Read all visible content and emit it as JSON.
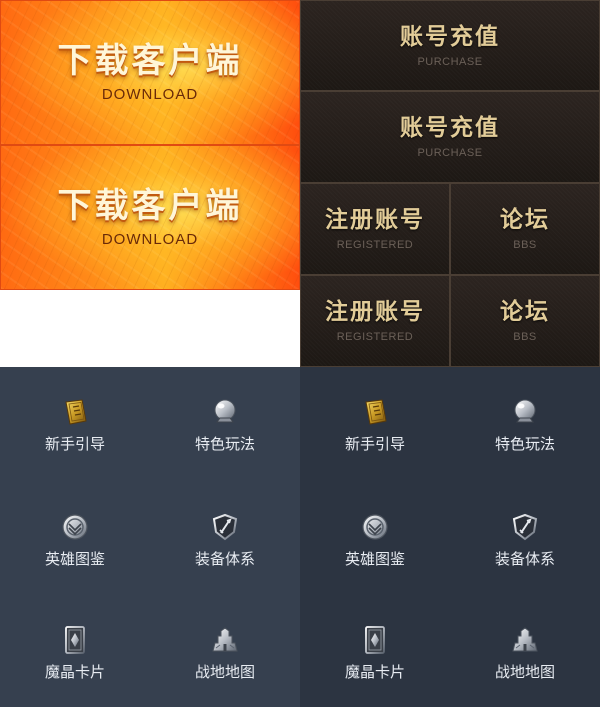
{
  "download": {
    "title": "下载客户端",
    "subtitle": "DOWNLOAD"
  },
  "tiles": {
    "purchase": {
      "title": "账号充值",
      "subtitle": "PURCHASE"
    },
    "register": {
      "title": "注册账号",
      "subtitle": "REGISTERED"
    },
    "forum": {
      "title": "论坛",
      "subtitle": "BBS"
    }
  },
  "nav": [
    {
      "label": "新手引导",
      "icon": "scroll-book-icon"
    },
    {
      "label": "特色玩法",
      "icon": "crystal-ball-icon"
    },
    {
      "label": "英雄图鉴",
      "icon": "hero-emblem-icon"
    },
    {
      "label": "装备体系",
      "icon": "sword-shield-icon"
    },
    {
      "label": "魔晶卡片",
      "icon": "magic-card-icon"
    },
    {
      "label": "战地地图",
      "icon": "castle-map-icon"
    }
  ],
  "colors": {
    "download_orange": "#ff8a18",
    "tile_gold_text": "#e2cc98",
    "panel_left_bg": "#36404f",
    "panel_right_bg": "#2c3441"
  }
}
